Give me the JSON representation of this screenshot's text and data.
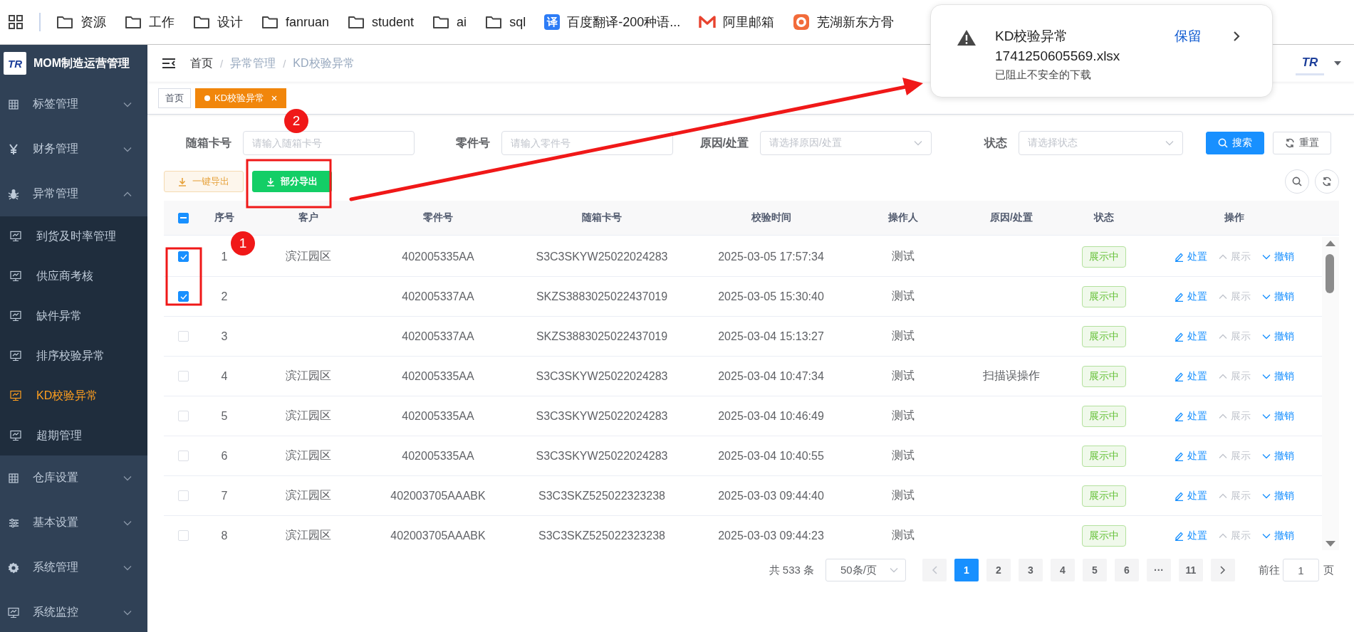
{
  "bookmarks": [
    {
      "kind": "apps"
    },
    {
      "kind": "folder",
      "label": "资源"
    },
    {
      "kind": "folder",
      "label": "工作"
    },
    {
      "kind": "folder",
      "label": "设计"
    },
    {
      "kind": "folder",
      "label": "fanruan"
    },
    {
      "kind": "folder",
      "label": "student"
    },
    {
      "kind": "folder",
      "label": "ai"
    },
    {
      "kind": "folder",
      "label": "sql"
    },
    {
      "kind": "badge",
      "badge_text": "译",
      "label": "百度翻译-200种语..."
    },
    {
      "kind": "mail",
      "label": "阿里邮箱"
    },
    {
      "kind": "emblem",
      "label": "芜湖新东方骨"
    }
  ],
  "sidebar": {
    "logo_text": "TR",
    "title": "MOM制造运营管理",
    "items": [
      {
        "label": "标签管理",
        "expanded": false
      },
      {
        "label": "财务管理",
        "expanded": false
      },
      {
        "label": "异常管理",
        "expanded": true,
        "children": [
          {
            "label": "到货及时率管理",
            "selected": false
          },
          {
            "label": "供应商考核",
            "selected": false
          },
          {
            "label": "缺件异常",
            "selected": false
          },
          {
            "label": "排序校验异常",
            "selected": false
          },
          {
            "label": "KD校验异常",
            "selected": true
          },
          {
            "label": "超期管理",
            "selected": false
          }
        ]
      },
      {
        "label": "仓库设置",
        "expanded": false
      },
      {
        "label": "基本设置",
        "expanded": false
      },
      {
        "label": "系统管理",
        "expanded": false
      },
      {
        "label": "系统监控",
        "expanded": false
      }
    ]
  },
  "header": {
    "breadcrumb": [
      "首页",
      "异常管理",
      "KD校验异常"
    ],
    "separator": "/",
    "avatar_text": "TR",
    "tabs": [
      {
        "label": "首页",
        "selected": false
      },
      {
        "label": "KD校验异常",
        "selected": true
      }
    ]
  },
  "filters": {
    "fields": [
      {
        "kind": "input",
        "label": "随箱卡号",
        "placeholder": "请输入随箱卡号"
      },
      {
        "kind": "input",
        "label": "零件号",
        "placeholder": "请输入零件号"
      },
      {
        "kind": "select",
        "label": "原因/处置",
        "placeholder": "请选择原因/处置"
      },
      {
        "kind": "select",
        "label": "状态",
        "placeholder": "请选择状态"
      }
    ],
    "buttons": [
      {
        "kind": "primary",
        "label": "搜索"
      },
      {
        "kind": "default",
        "label": "重置"
      }
    ]
  },
  "toolbar": {
    "buttons": [
      {
        "kind": "warning",
        "label": "一键导出"
      },
      {
        "kind": "success",
        "label": "部分导出"
      }
    ]
  },
  "table": {
    "header_checkbox": {
      "indeterminate": true
    },
    "columns": [
      "序号",
      "客户",
      "零件号",
      "随箱卡号",
      "校验时间",
      "操作人",
      "原因/处置",
      "状态",
      "操作"
    ],
    "rows": [
      {
        "checked": true,
        "seq": "1",
        "customer": "滨江园区",
        "part_no": "402005335AA",
        "card_no": "S3C3SKYW25022024283",
        "time": "2025-03-05 17:57:34",
        "operator": "测试",
        "status": "展示中",
        "actions": [
          {
            "kind": "edit",
            "label": "处置",
            "disabled": false
          },
          {
            "kind": "up",
            "label": "展示",
            "disabled": true
          },
          {
            "kind": "down",
            "label": "撤销",
            "disabled": false
          }
        ]
      },
      {
        "checked": true,
        "seq": "2",
        "part_no": "402005337AA",
        "card_no": "SKZS3883025022437019",
        "time": "2025-03-05 15:30:40",
        "operator": "测试",
        "status": "展示中",
        "actions": [
          {
            "kind": "edit",
            "label": "处置",
            "disabled": false
          },
          {
            "kind": "up",
            "label": "展示",
            "disabled": true
          },
          {
            "kind": "down",
            "label": "撤销",
            "disabled": false
          }
        ]
      },
      {
        "checked": false,
        "seq": "3",
        "part_no": "402005337AA",
        "card_no": "SKZS3883025022437019",
        "time": "2025-03-04 15:13:27",
        "operator": "测试",
        "status": "展示中",
        "actions": [
          {
            "kind": "edit",
            "label": "处置",
            "disabled": false
          },
          {
            "kind": "up",
            "label": "展示",
            "disabled": true
          },
          {
            "kind": "down",
            "label": "撤销",
            "disabled": false
          }
        ]
      },
      {
        "checked": false,
        "seq": "4",
        "customer": "滨江园区",
        "part_no": "402005335AA",
        "card_no": "S3C3SKYW25022024283",
        "time": "2025-03-04 10:47:34",
        "operator": "测试",
        "reason": "扫描误操作",
        "status": "展示中",
        "actions": [
          {
            "kind": "edit",
            "label": "处置",
            "disabled": false
          },
          {
            "kind": "up",
            "label": "展示",
            "disabled": true
          },
          {
            "kind": "down",
            "label": "撤销",
            "disabled": false
          }
        ]
      },
      {
        "checked": false,
        "seq": "5",
        "customer": "滨江园区",
        "part_no": "402005335AA",
        "card_no": "S3C3SKYW25022024283",
        "time": "2025-03-04 10:46:49",
        "operator": "测试",
        "status": "展示中",
        "actions": [
          {
            "kind": "edit",
            "label": "处置",
            "disabled": false
          },
          {
            "kind": "up",
            "label": "展示",
            "disabled": true
          },
          {
            "kind": "down",
            "label": "撤销",
            "disabled": false
          }
        ]
      },
      {
        "checked": false,
        "seq": "6",
        "customer": "滨江园区",
        "part_no": "402005335AA",
        "card_no": "S3C3SKYW25022024283",
        "time": "2025-03-04 10:40:55",
        "operator": "测试",
        "status": "展示中",
        "actions": [
          {
            "kind": "edit",
            "label": "处置",
            "disabled": false
          },
          {
            "kind": "up",
            "label": "展示",
            "disabled": true
          },
          {
            "kind": "down",
            "label": "撤销",
            "disabled": false
          }
        ]
      },
      {
        "checked": false,
        "seq": "7",
        "customer": "滨江园区",
        "part_no": "402003705AAABK",
        "card_no": "S3C3SKZ525022323238",
        "time": "2025-03-03 09:44:40",
        "operator": "测试",
        "status": "展示中",
        "actions": [
          {
            "kind": "edit",
            "label": "处置",
            "disabled": false
          },
          {
            "kind": "up",
            "label": "展示",
            "disabled": true
          },
          {
            "kind": "down",
            "label": "撤销",
            "disabled": false
          }
        ]
      },
      {
        "checked": false,
        "seq": "8",
        "customer": "滨江园区",
        "part_no": "402003705AAABK",
        "card_no": "S3C3SKZ525022323238",
        "time": "2025-03-03 09:44:23",
        "operator": "测试",
        "status": "展示中",
        "actions": [
          {
            "kind": "edit",
            "label": "处置",
            "disabled": false
          },
          {
            "kind": "up",
            "label": "展示",
            "disabled": true
          },
          {
            "kind": "down",
            "label": "撤销",
            "disabled": false
          }
        ]
      }
    ]
  },
  "pagination": {
    "total": "共 533 条",
    "page_size": "50条/页",
    "pages": [
      {
        "label": "1",
        "selected": true
      },
      {
        "label": "2",
        "selected": false
      },
      {
        "label": "3",
        "selected": false
      },
      {
        "label": "4",
        "selected": false
      },
      {
        "label": "5",
        "selected": false
      },
      {
        "label": "6",
        "selected": false
      },
      {
        "label": "···",
        "selected": false
      },
      {
        "label": "11",
        "selected": false
      }
    ],
    "goto_label": "前往",
    "goto_value": "1",
    "goto_suffix": "页"
  },
  "download": {
    "title": "KD校验异常",
    "filename": "1741250605569.xlsx",
    "note": "已阻止不安全的下载",
    "action": "保留"
  },
  "annotations": {
    "markers": [
      {
        "label": "1"
      },
      {
        "label": "2"
      }
    ]
  }
}
